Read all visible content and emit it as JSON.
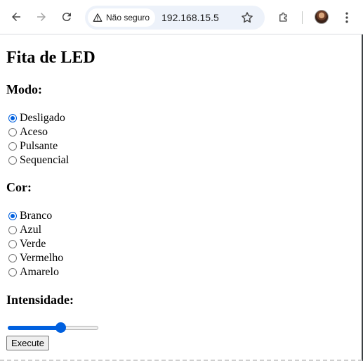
{
  "browser": {
    "security_label": "Não seguro",
    "url": "192.168.15.5",
    "icons": [
      "back-arrow-icon",
      "forward-arrow-icon",
      "reload-icon",
      "warning-triangle-icon",
      "star-icon",
      "extensions-puzzle-icon",
      "kebab-menu-icon"
    ]
  },
  "page": {
    "title": "Fita de LED",
    "mode": {
      "heading": "Modo:",
      "options": [
        {
          "label": "Desligado",
          "checked": true
        },
        {
          "label": "Aceso",
          "checked": false
        },
        {
          "label": "Pulsante",
          "checked": false
        },
        {
          "label": "Sequencial",
          "checked": false
        }
      ]
    },
    "color": {
      "heading": "Cor:",
      "options": [
        {
          "label": "Branco",
          "checked": true
        },
        {
          "label": "Azul",
          "checked": false
        },
        {
          "label": "Verde",
          "checked": false
        },
        {
          "label": "Vermelho",
          "checked": false
        },
        {
          "label": "Amarelo",
          "checked": false
        }
      ]
    },
    "intensity": {
      "heading": "Intensidade:",
      "value_percent": 60
    },
    "execute_label": "Execute"
  },
  "colors": {
    "accent": "#0060df",
    "omnibox_bg": "#edf2fa"
  }
}
